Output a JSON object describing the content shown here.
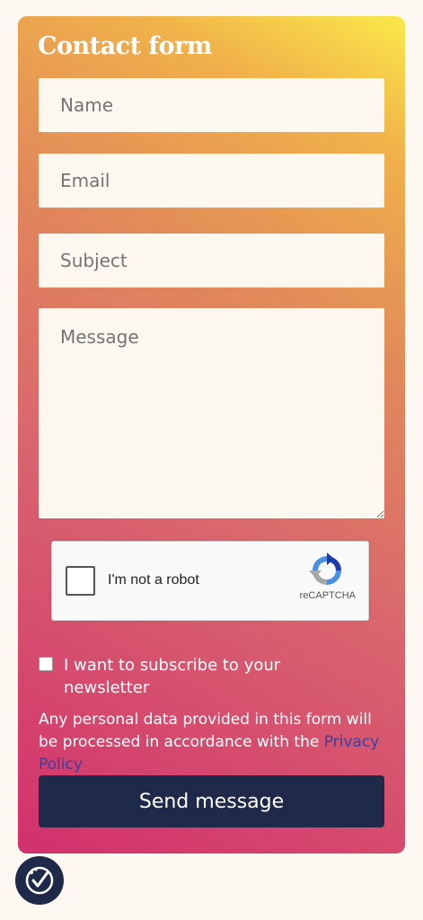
{
  "form": {
    "title": "Contact form",
    "name_placeholder": "Name",
    "email_placeholder": "Email",
    "subject_placeholder": "Subject",
    "message_placeholder": "Message",
    "recaptcha": {
      "label": "I'm not a robot",
      "brand": "reCAPTCHA",
      "icon": "recaptcha-logo-icon"
    },
    "newsletter_label": "I want to subscribe to your newsletter",
    "privacy_text": "Any personal data provided in this form will be processed in accordance with the ",
    "privacy_link": "Privacy Policy",
    "send_label": "Send message"
  },
  "fab": {
    "icon": "accessibility-check-icon"
  },
  "colors": {
    "page_bg": "#fdf8f2",
    "gradient_top": "#fbe84a",
    "gradient_bottom": "#d2306d",
    "button": "#1f2a4b",
    "field_bg": "#fcf7ef",
    "link": "#3a3fa0"
  }
}
